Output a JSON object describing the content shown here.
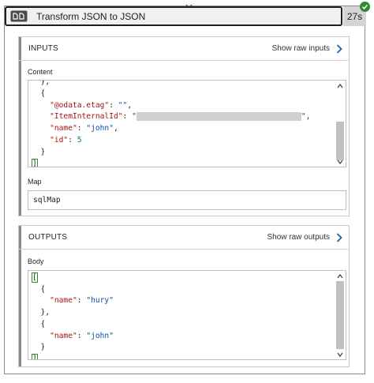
{
  "action": {
    "title": "Transform JSON to JSON",
    "duration": "27s",
    "status": "succeeded",
    "icon": "transform-icon",
    "status_color": "#2e8b2e"
  },
  "inputs": {
    "section_title": "INPUTS",
    "show_raw_label": "Show raw inputs",
    "content_label": "Content",
    "content_lines": [
      [
        {
          "t": "p",
          "v": "  },"
        }
      ],
      [
        {
          "t": "p",
          "v": "  {"
        }
      ],
      [
        {
          "t": "k",
          "v": "    \"@odata.etag\""
        },
        {
          "t": "p",
          "v": ": "
        },
        {
          "t": "s",
          "v": "\"\""
        },
        {
          "t": "p",
          "v": ","
        }
      ],
      [
        {
          "t": "k",
          "v": "    \"ItemInternalId\""
        },
        {
          "t": "p",
          "v": ": "
        },
        {
          "t": "s",
          "v": "\""
        },
        {
          "t": "r",
          "v": ""
        },
        {
          "t": "s",
          "v": "\""
        },
        {
          "t": "p",
          "v": ","
        }
      ],
      [
        {
          "t": "k",
          "v": "    \"name\""
        },
        {
          "t": "p",
          "v": ": "
        },
        {
          "t": "s",
          "v": "\"john\""
        },
        {
          "t": "p",
          "v": ","
        }
      ],
      [
        {
          "t": "k",
          "v": "    \"id\""
        },
        {
          "t": "p",
          "v": ": "
        },
        {
          "t": "n",
          "v": "5"
        }
      ],
      [
        {
          "t": "p",
          "v": "  }"
        }
      ],
      [
        {
          "t": "b",
          "v": "]"
        }
      ]
    ],
    "map_label": "Map",
    "map_value": "sqlMap"
  },
  "outputs": {
    "section_title": "OUTPUTS",
    "show_raw_label": "Show raw outputs",
    "body_label": "Body",
    "body_lines": [
      [
        {
          "t": "b",
          "v": "["
        }
      ],
      [
        {
          "t": "p",
          "v": "  {"
        }
      ],
      [
        {
          "t": "k",
          "v": "    \"name\""
        },
        {
          "t": "p",
          "v": ": "
        },
        {
          "t": "s",
          "v": "\"hury\""
        }
      ],
      [
        {
          "t": "p",
          "v": "  },"
        }
      ],
      [
        {
          "t": "p",
          "v": "  {"
        }
      ],
      [
        {
          "t": "k",
          "v": "    \"name\""
        },
        {
          "t": "p",
          "v": ": "
        },
        {
          "t": "s",
          "v": "\"john\""
        }
      ],
      [
        {
          "t": "p",
          "v": "  }"
        }
      ],
      [
        {
          "t": "b",
          "v": "]"
        }
      ]
    ]
  }
}
